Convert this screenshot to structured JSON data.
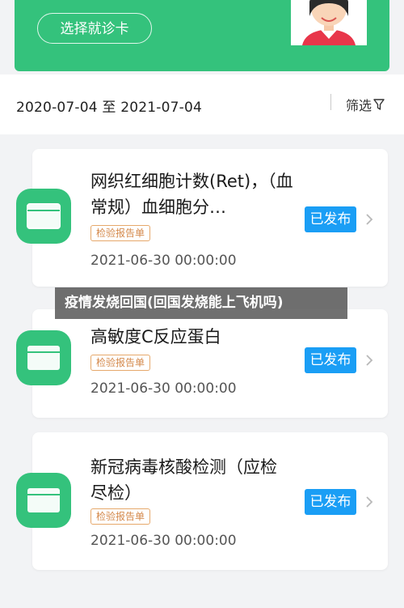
{
  "header": {
    "select_card_label": "选择就诊卡"
  },
  "filter_bar": {
    "date_range": "2020-07-04 至 2021-07-04",
    "filter_label": "筛选"
  },
  "records": [
    {
      "title": "网织红细胞计数(Ret)，（血常规）血细胞分…",
      "tag": "检验报告单",
      "date": "2021-06-30 00:00:00",
      "status": "已发布"
    },
    {
      "title": "高敏度C反应蛋白",
      "tag": "检验报告单",
      "date": "2021-06-30 00:00:00",
      "status": "已发布"
    },
    {
      "title": "新冠病毒核酸检测（应检尽检）",
      "tag": "检验报告单",
      "date": "2021-06-30 00:00:00",
      "status": "已发布"
    }
  ],
  "watermark": "疫情发烧回国(回国发烧能上飞机吗)",
  "colors": {
    "brand_green": "#34c27c",
    "status_blue": "#1a9ef5",
    "tag_orange": "#d4884a"
  },
  "icons": [
    "avatar-illustration",
    "document-icon",
    "filter-funnel-icon",
    "chevron-right-icon"
  ]
}
